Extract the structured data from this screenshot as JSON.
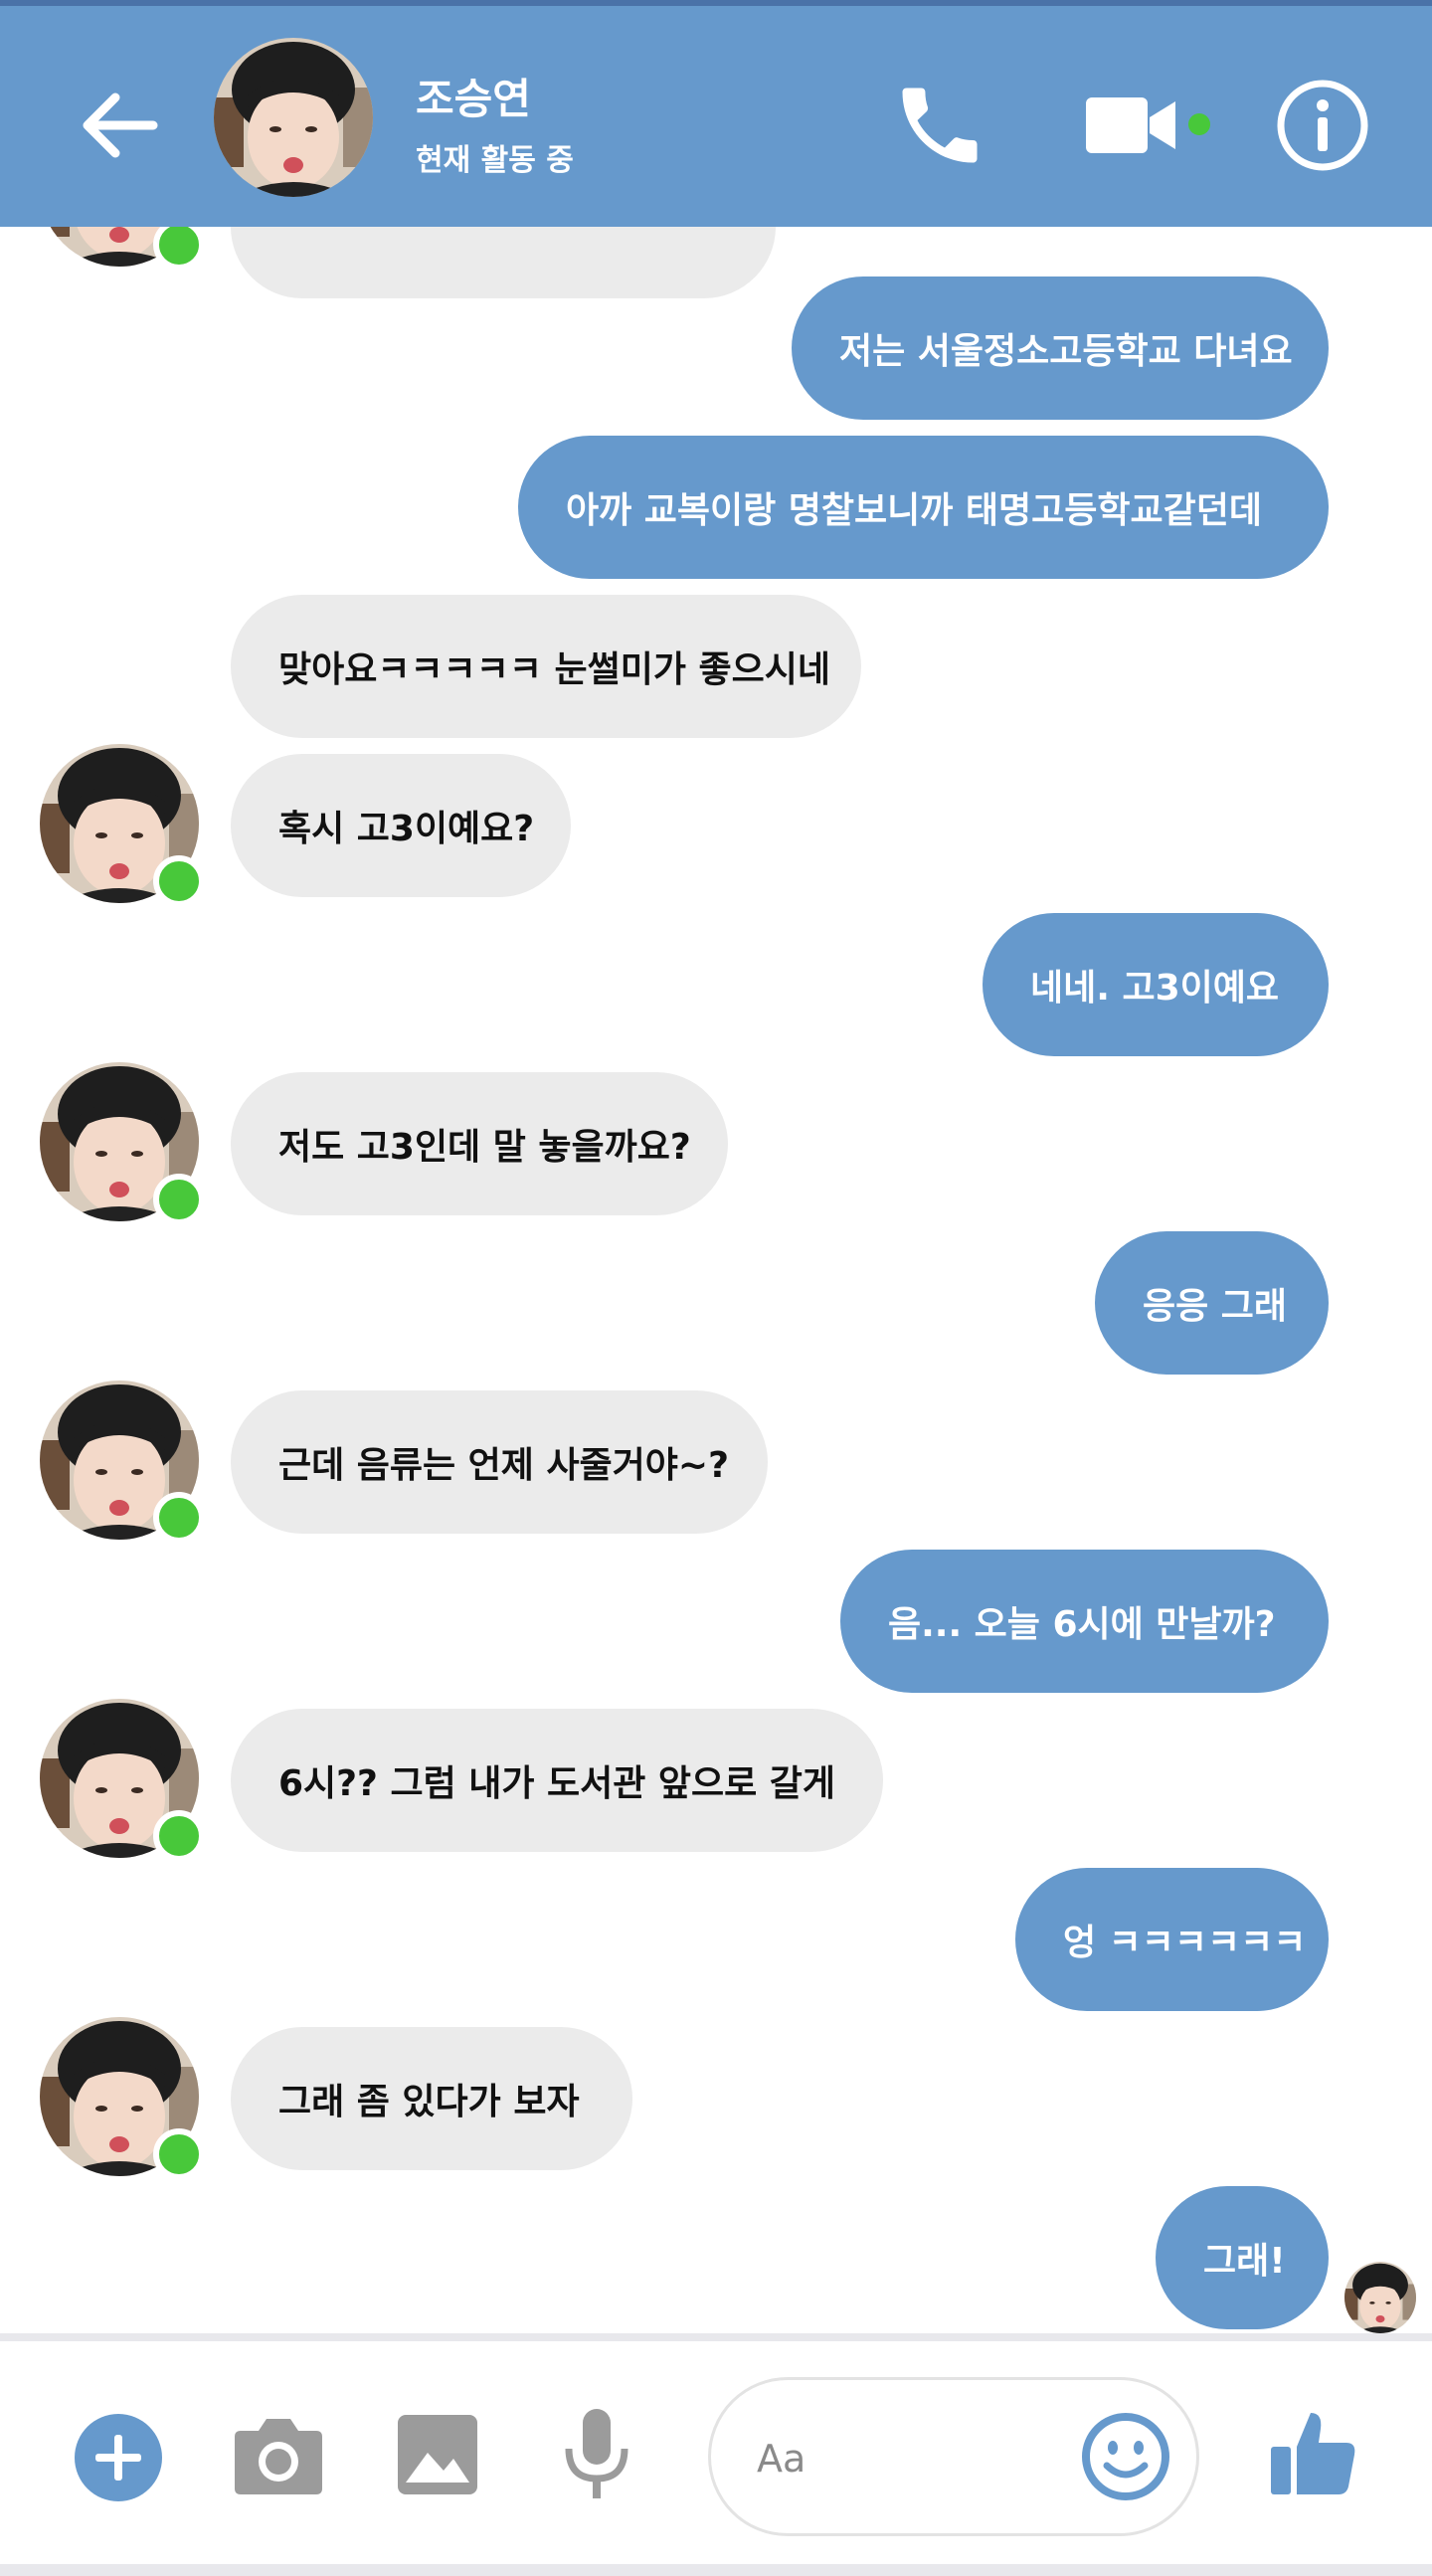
{
  "header": {
    "contact_name": "조승연",
    "status": "현재 활동 중",
    "back_icon": "arrow-left-icon",
    "call_icon": "phone-icon",
    "video_icon": "video-camera-icon",
    "info_icon": "info-icon"
  },
  "messages": [
    {
      "dir": "out",
      "text": "저는 서울정소고등학교 다녀요"
    },
    {
      "dir": "out",
      "text": "아까 교복이랑 명찰보니까 태명고등학교같던데"
    },
    {
      "dir": "in",
      "text": "맞아요ㅋㅋㅋㅋㅋ 눈썰미가 좋으시네"
    },
    {
      "dir": "in",
      "text": "혹시 고3이예요?"
    },
    {
      "dir": "out",
      "text": "네네. 고3이예요"
    },
    {
      "dir": "in",
      "text": "저도 고3인데 말 놓을까요?"
    },
    {
      "dir": "out",
      "text": "응응 그래"
    },
    {
      "dir": "in",
      "text": "근데 음류는 언제 사줄거야~?"
    },
    {
      "dir": "out",
      "text": "음... 오늘 6시에 만날까?"
    },
    {
      "dir": "in",
      "text": "6시?? 그럼 내가 도서관 앞으로 갈게"
    },
    {
      "dir": "out",
      "text": "엉 ㅋㅋㅋㅋㅋㅋ"
    },
    {
      "dir": "in",
      "text": "그래 좀 있다가 보자"
    },
    {
      "dir": "out",
      "text": "그래!"
    }
  ],
  "composer": {
    "placeholder": "Aa",
    "plus_icon": "plus-circle-icon",
    "camera_icon": "camera-icon",
    "image_icon": "image-icon",
    "mic_icon": "microphone-icon",
    "emoji_icon": "smiley-icon",
    "like_icon": "thumbs-up-icon"
  },
  "colors": {
    "header": "#6699cc",
    "outgoing_bubble": "#6699cc",
    "incoming_bubble": "#ebebeb",
    "online": "#48c83a"
  }
}
